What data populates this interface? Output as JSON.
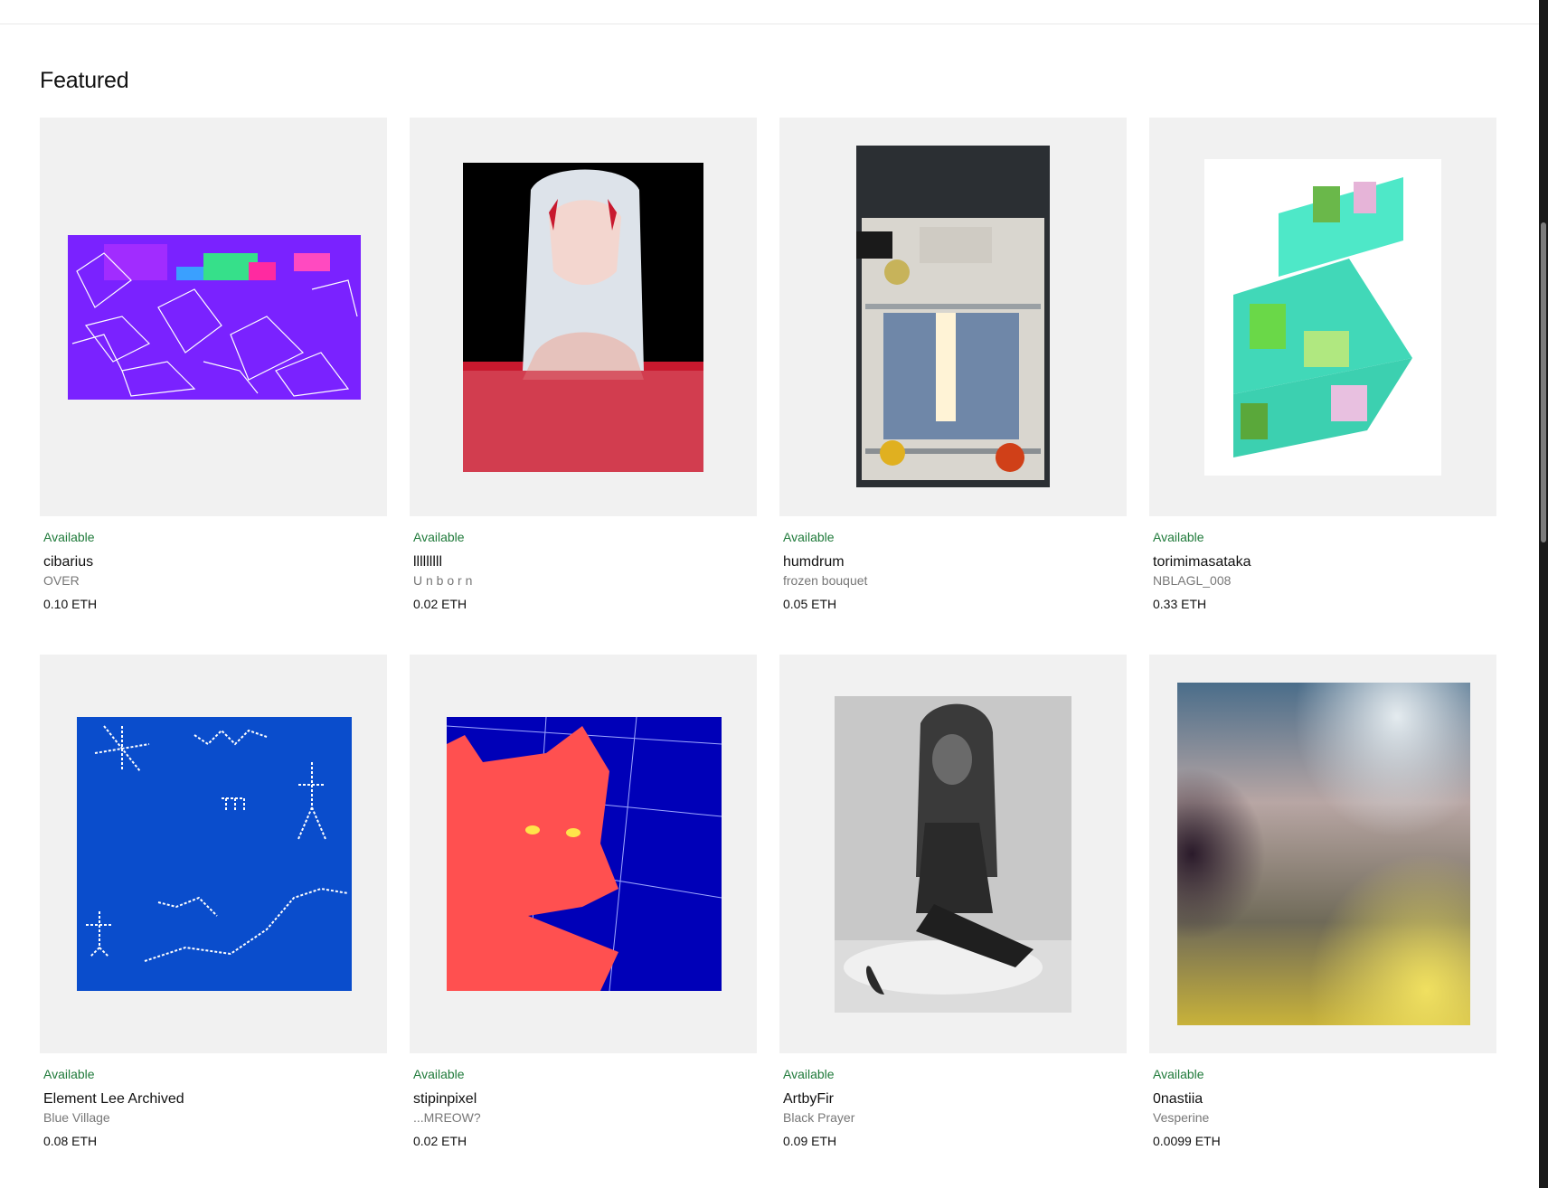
{
  "section": {
    "title": "Featured"
  },
  "items": [
    {
      "status": "Available",
      "artist": "cibarius",
      "title": "OVER",
      "price": "0.10 ETH"
    },
    {
      "status": "Available",
      "artist": "lllllllll",
      "title": "U n b o r n",
      "price": "0.02 ETH"
    },
    {
      "status": "Available",
      "artist": "humdrum",
      "title": "frozen bouquet",
      "price": "0.05 ETH"
    },
    {
      "status": "Available",
      "artist": "torimimasataka",
      "title": "NBLAGL_008",
      "price": "0.33 ETH"
    },
    {
      "status": "Available",
      "artist": "Element Lee Archived",
      "title": "Blue Village",
      "price": "0.08 ETH"
    },
    {
      "status": "Available",
      "artist": "stipinpixel",
      "title": "...MREOW?",
      "price": "0.02 ETH"
    },
    {
      "status": "Available",
      "artist": "ArtbyFir",
      "title": "Black Prayer",
      "price": "0.09 ETH"
    },
    {
      "status": "Available",
      "artist": "0nastiia",
      "title": "Vesperine",
      "price": "0.0099 ETH"
    }
  ],
  "colors": {
    "available": "#1f7a3a",
    "card_bg": "#f1f1f1"
  }
}
